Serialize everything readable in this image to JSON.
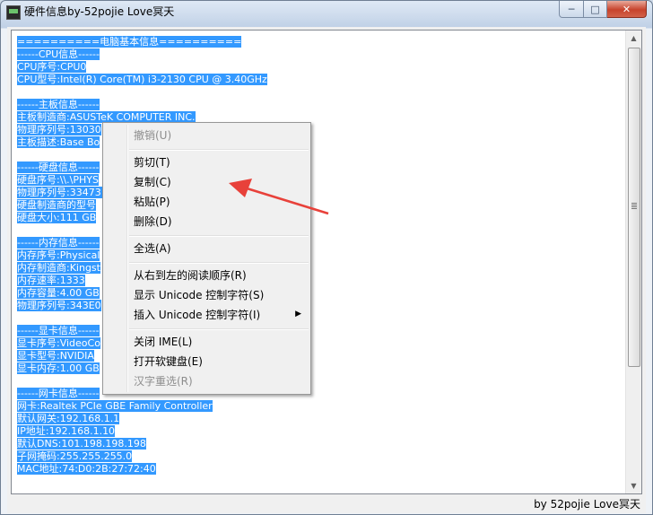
{
  "window": {
    "title": "硬件信息by-52pojie Love冥天",
    "minimize": "─",
    "maximize": "□",
    "close": "✕"
  },
  "content": {
    "lines": [
      "==========电脑基本信息==========",
      "------CPU信息------",
      "CPU序号:CPU0",
      "CPU型号:Intel(R) Core(TM) i3-2130 CPU @ 3.40GHz",
      "",
      "------主板信息------",
      "主板制造商:ASUSTeK COMPUTER INC.",
      "物理序列号:13030",
      "主板描述:Base Bo",
      "",
      "------硬盘信息------",
      "硬盘序号:\\\\.\\PHYS",
      "物理序列号:33473                                   20",
      "硬盘制造商的型号",
      "硬盘大小:111 GB",
      "",
      "------内存信息------",
      "内存序号:Physical",
      "内存制造商:Kingst",
      "内存速率:1333",
      "内存容量:4.00 GB",
      "物理序列号:343E0",
      "",
      "------显卡信息------",
      "显卡序号:VideoCo",
      "显卡型号:NVIDIA",
      "显卡内存:1.00 GB",
      "",
      "------网卡信息------",
      "网卡:Realtek PCIe GBE Family Controller",
      "默认网关:192.168.1.1",
      "IP地址:192.168.1.10",
      "默认DNS:101.198.198.198",
      "子网掩码:255.255.255.0",
      "MAC地址:74:D0:2B:27:72:40"
    ]
  },
  "context_menu": {
    "undo": "撤销(U)",
    "cut": "剪切(T)",
    "copy": "复制(C)",
    "paste": "粘贴(P)",
    "delete": "删除(D)",
    "select_all": "全选(A)",
    "rtl": "从右到左的阅读顺序(R)",
    "show_unicode": "显示 Unicode 控制字符(S)",
    "insert_unicode": "插入 Unicode 控制字符(I)",
    "close_ime": "关闭 IME(L)",
    "open_keyboard": "打开软键盘(E)",
    "reconvert": "汉字重选(R)"
  },
  "status_bar": {
    "text": "by 52pojie Love冥天"
  },
  "colors": {
    "selection": "#3399ff",
    "annotation_arrow": "#e8413a"
  }
}
